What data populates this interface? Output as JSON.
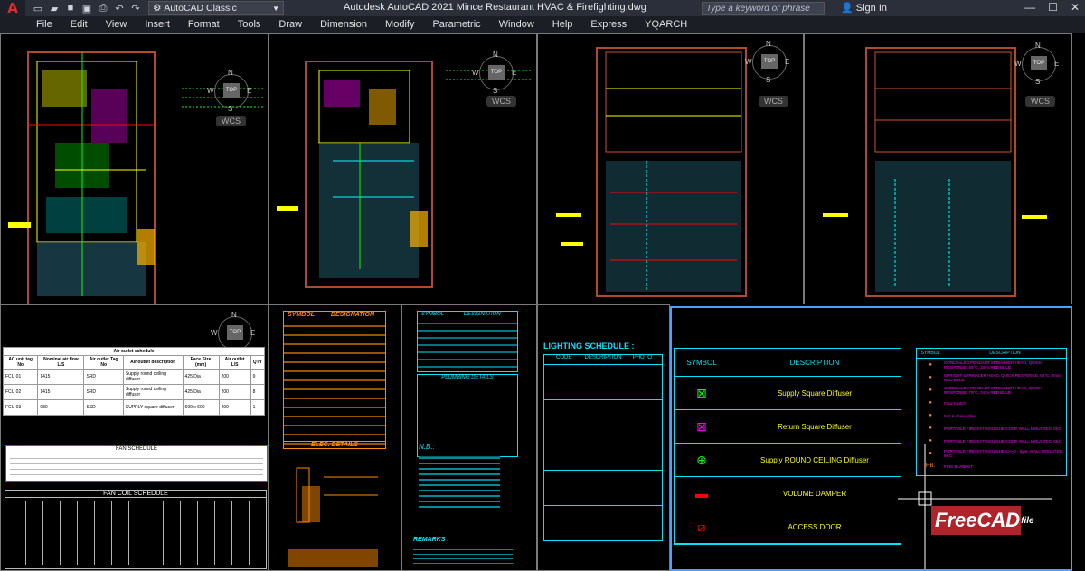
{
  "app": {
    "workspace": "AutoCAD Classic",
    "title": "Autodesk AutoCAD 2021   Mince Restaurant HVAC & Firefighting.dwg",
    "search_placeholder": "Type a keyword or phrase",
    "signin": "Sign In"
  },
  "menu": [
    "File",
    "Edit",
    "View",
    "Insert",
    "Format",
    "Tools",
    "Draw",
    "Dimension",
    "Modify",
    "Parametric",
    "Window",
    "Help",
    "Express",
    "YQARCH"
  ],
  "viewcube": {
    "top": "TOP",
    "n": "N",
    "s": "S",
    "e": "E",
    "w": "W",
    "wcs": "WCS"
  },
  "air_outlet": {
    "title": "Air outlet schedule",
    "headers": [
      "AC unit tag No",
      "Nominal air flow L/S",
      "Air outlet Tag No",
      "Air outlet description",
      "Face Size (mm)",
      "Air outlet L/S",
      "QTY"
    ],
    "rows": [
      [
        "FCU 01",
        "1415",
        "SRD",
        "Supply round ceiling diffuser",
        "425 Dia",
        "200",
        "9"
      ],
      [
        "FCU 02",
        "1415",
        "SRD",
        "Supply round ceiling diffuser",
        "425 Dia",
        "200",
        "8"
      ],
      [
        "FCU 03",
        "980",
        "SSD",
        "SUPPLY square diffuser",
        "600 x 600",
        "200",
        "1"
      ]
    ]
  },
  "fan_schedule_title": "FAN SCHEDULE",
  "fan_coil_title": "FAN COIL SCHEDULE",
  "legend_symbol": "SYMBOL",
  "legend_designation": "DESIGNATION",
  "elec_details": "ELEC. DETAILS",
  "plumbing_details": "PLUMBING DETAILS",
  "nb": "N.B.:",
  "remarks": "REMARKS :",
  "lighting": {
    "title": "LIGHTING SCHEDULE :",
    "headers": [
      "CODE",
      "DESCRIPTION",
      "PHOTO"
    ]
  },
  "hvac_legend": {
    "symbol": "SYMBOL",
    "description": "DESCRIPTION",
    "items": [
      "Supply Square Diffuser",
      "Return Square Diffuser",
      "Supply ROUND CEILING Diffuser",
      "VOLUME DAMPER",
      "ACCESS DOOR"
    ]
  },
  "fire_legend": {
    "symbol": "SYMBOL",
    "description": "DESCRIPTION",
    "items": [
      "CONCEALED PENDANT SPRINKLER HEAD, QUICK RESPONSE, 68°C, 3mm RED BULB",
      "UPRIGHT SPRINKLER HEAD, QUICK RESPONSE, 68°C, 3mm RED BULB",
      "CONCEALED PENDANT SPRINKLER HEAD, QUICK RESPONSE, 79°C, 3mm RED BULB",
      "Flow Switch",
      "test & drain valve",
      "PORTABLE FIRE EXTINGUISHER DCP, WALL MOUNTED. 6KG",
      "PORTABLE FIRE EXTINGUISHER DCP, WALL MOUNTED. 6KG",
      "PORTABLE FIRE EXTINGUISHER H₂O - type, WALL MOUNTED. 6KG",
      "FIRE BLANKET"
    ],
    "fb": "F.B."
  },
  "brand": {
    "free": "Free",
    "cad": "CAD",
    "file": "file"
  },
  "colors": {
    "titlebar": "#2b2f3a",
    "menubar": "#1c1e25",
    "accent": "#4aa0ff",
    "cyan": "#00e5ff",
    "orange": "#ff8c00"
  }
}
